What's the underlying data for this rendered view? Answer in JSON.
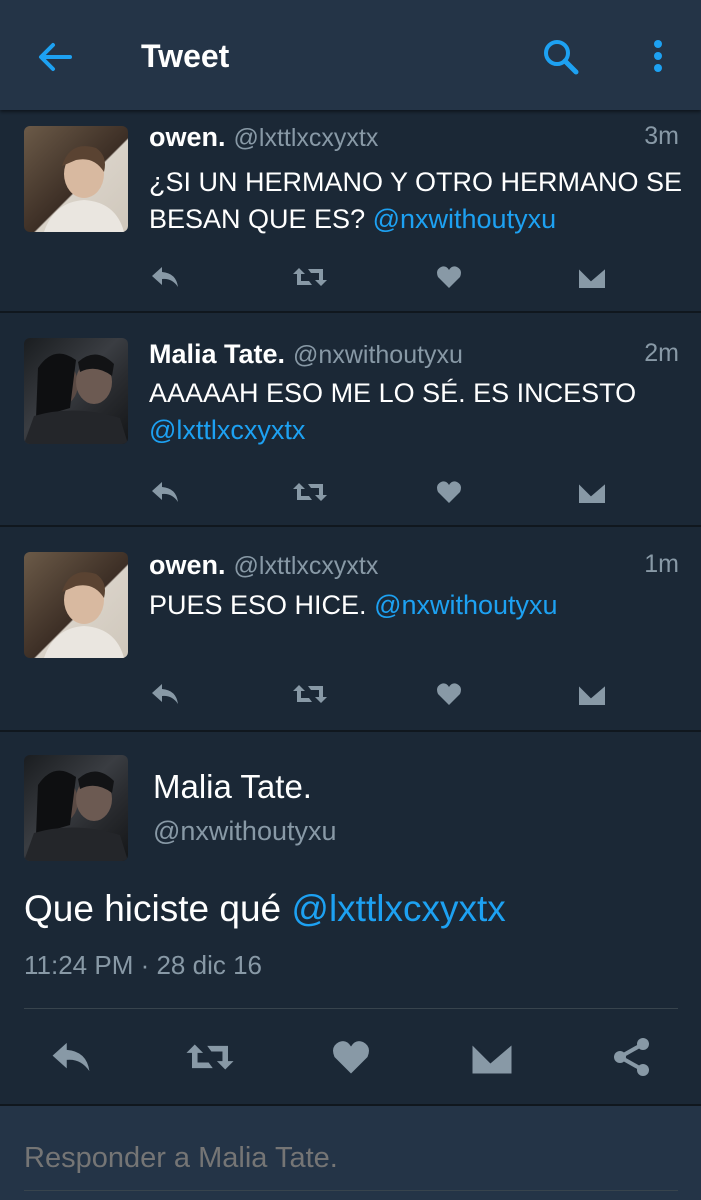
{
  "appbar": {
    "title": "Tweet",
    "back_icon": "arrow-left-icon",
    "search_icon": "search-icon",
    "more_icon": "more-vertical-icon"
  },
  "colors": {
    "background": "#1b2836",
    "bar": "#243447",
    "accent": "#1da1f2",
    "secondary_text": "#8899a6",
    "icon": "#8899a6"
  },
  "replies": [
    {
      "name": "owen.",
      "handle": "@lxttlxcxyxtx",
      "time": "3m",
      "text": "¿SI UN HERMANO Y OTRO HERMANO SE BESAN QUE ES? ",
      "mention": "@nxwithoutyxu",
      "avatar": "owen"
    },
    {
      "name": "Malia Tate.",
      "handle": "@nxwithoutyxu",
      "time": "2m",
      "text": "AAAAAH ESO ME LO SÉ. ES INCESTO ",
      "mention": "@lxttlxcxyxtx",
      "avatar": "malia"
    },
    {
      "name": "owen.",
      "handle": "@lxttlxcxyxtx",
      "time": "1m",
      "text": "PUES ESO HICE. ",
      "mention": "@nxwithoutyxu",
      "avatar": "owen"
    }
  ],
  "main_tweet": {
    "name": "Malia Tate.",
    "handle": "@nxwithoutyxu",
    "text": "Que hiciste qué ",
    "mention": "@lxttlxcxyxtx",
    "timestamp": "11:24 PM · 28 dic 16"
  },
  "action_icons": [
    "reply-icon",
    "retweet-icon",
    "like-icon",
    "message-icon"
  ],
  "detail_action_icons": [
    "reply-icon",
    "retweet-icon",
    "like-icon",
    "message-icon",
    "share-icon"
  ],
  "reply_bar": {
    "placeholder": "Responder a Malia Tate."
  }
}
